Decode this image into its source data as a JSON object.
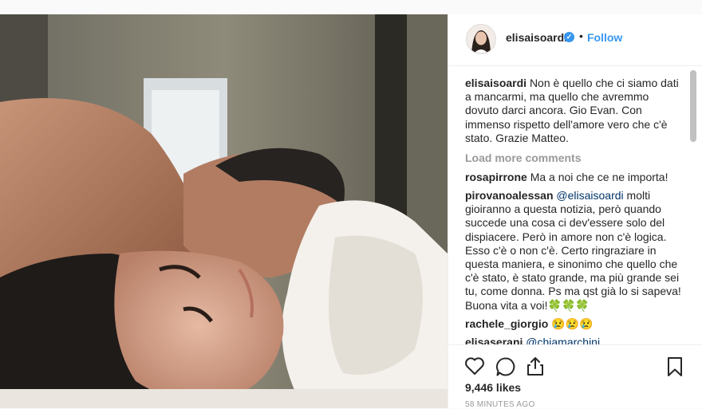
{
  "header": {
    "username": "elisaisoardi",
    "separator": "•",
    "follow_label": "Follow"
  },
  "caption": {
    "username": "elisaisoardi",
    "text": "Non è quello che ci siamo dati a mancarmi, ma quello che avremmo dovuto darci ancora. Gio Evan. Con immenso rispetto dell'amore vero che c'è stato. Grazie Matteo."
  },
  "load_more_label": "Load more comments",
  "comments": [
    {
      "username": "rosapirrone",
      "text": "Ma a noi che ce ne importa!"
    },
    {
      "username": "pirovanoalessan",
      "mention": "@elisaisoardi",
      "text": "molti gioiranno a questa notizia, però quando succede una cosa ci dev'essere solo del dispiacere. Però in amore non c'è logica. Esso c'è o non c'è. Certo ringraziare in questa maniera, e sinonimo che quello che c'è stato, è stato grande, ma più grande sei tu, come donna. Ps ma qst già lo si sapeva! Buona vita a voi!",
      "emoji": "🍀🍀🍀"
    },
    {
      "username": "rachele_giorgio",
      "emoji": "😢😢😢"
    },
    {
      "username": "elisaserani",
      "mention": "@chiamarchini"
    }
  ],
  "icons": {
    "like": "heart-icon",
    "comment": "comment-bubble-icon",
    "share": "share-icon",
    "save": "bookmark-icon",
    "verified": "verified-badge-icon"
  },
  "likes_label": "9,446 likes",
  "timestamp": "58 MINUTES AGO",
  "colors": {
    "link_blue": "#3897f0",
    "mention_blue": "#003569",
    "muted": "#999999"
  }
}
